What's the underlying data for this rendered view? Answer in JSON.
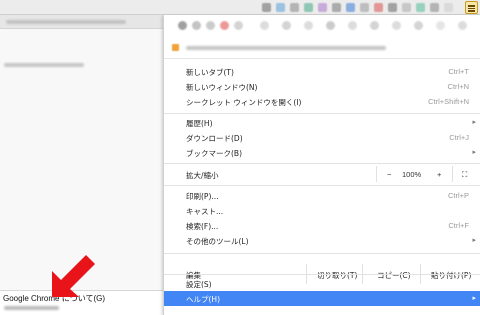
{
  "menu": {
    "new_tab": {
      "label": "新しいタブ(T)",
      "shortcut": "Ctrl+T"
    },
    "new_window": {
      "label": "新しいウィンドウ(N)",
      "shortcut": "Ctrl+N"
    },
    "incognito": {
      "label": "シークレット ウィンドウを開く(I)",
      "shortcut": "Ctrl+Shift+N"
    },
    "history": {
      "label": "履歴(H)"
    },
    "downloads": {
      "label": "ダウンロード(D)",
      "shortcut": "Ctrl+J"
    },
    "bookmarks": {
      "label": "ブックマーク(B)"
    },
    "zoom": {
      "label": "拡大/縮小",
      "minus": "−",
      "value": "100%",
      "plus": "+",
      "fullscreen": "⛶"
    },
    "print": {
      "label": "印刷(P)...",
      "shortcut": "Ctrl+P"
    },
    "cast": {
      "label": "キャスト..."
    },
    "find": {
      "label": "検索(F)...",
      "shortcut": "Ctrl+F"
    },
    "more_tools": {
      "label": "その他のツール(L)"
    },
    "edit": {
      "label": "編集",
      "cut": "切り取り(T)",
      "copy": "コピー(C)",
      "paste": "貼り付け(P)"
    },
    "settings": {
      "label": "設定(S)"
    },
    "help": {
      "label": "ヘルプ(H)"
    },
    "submenu_arrow": "▸"
  },
  "submenu": {
    "about": "Google Chrome について(G)"
  },
  "colors": {
    "highlight": "#4285f4",
    "arrow": "#e8141a",
    "menu_button": "#f7e7a8"
  }
}
